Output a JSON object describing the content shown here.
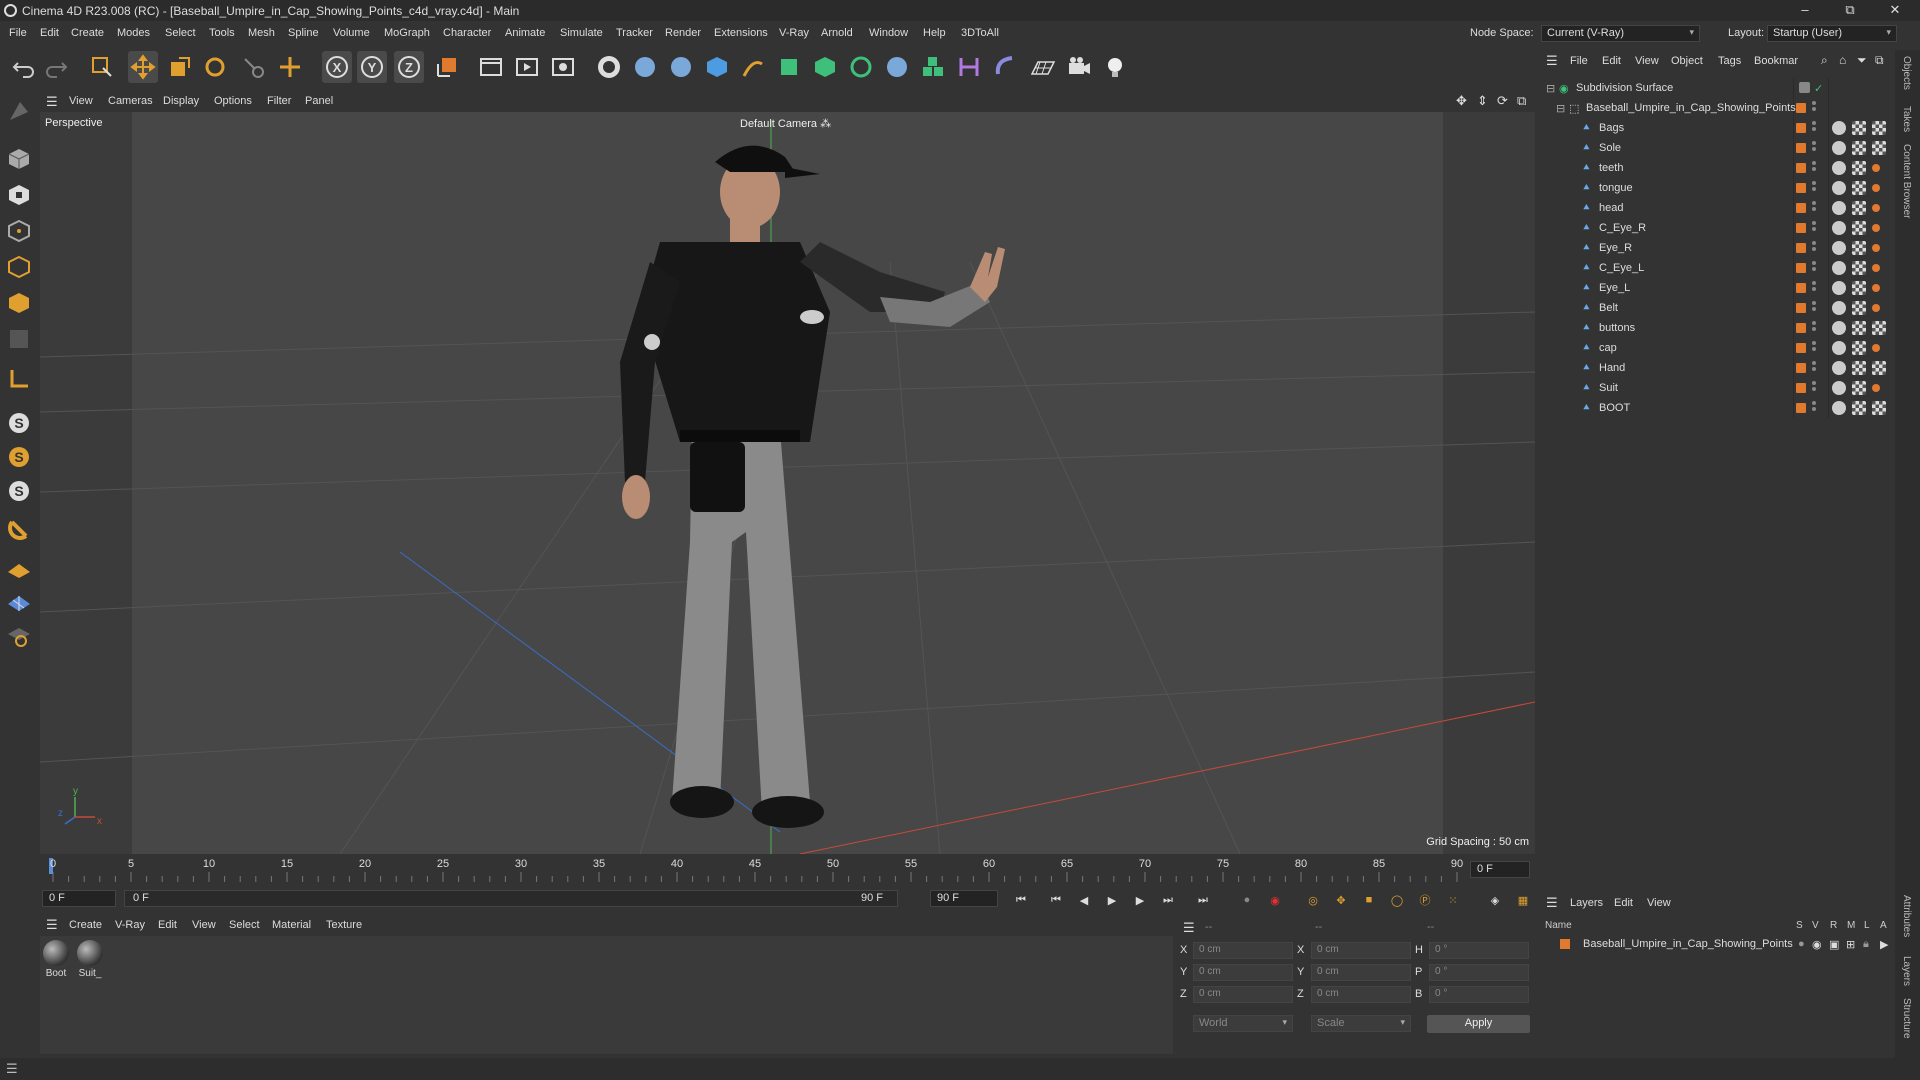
{
  "titlebar": {
    "title": "Cinema 4D R23.008 (RC) - [Baseball_Umpire_in_Cap_Showing_Points_c4d_vray.c4d] - Main",
    "minimize": "–",
    "restore": "⧉",
    "close": "✕"
  },
  "menubar": {
    "items": [
      "File",
      "Edit",
      "Create",
      "Modes",
      "Select",
      "Tools",
      "Mesh",
      "Spline",
      "Volume",
      "MoGraph",
      "Character",
      "Animate",
      "Simulate",
      "Tracker",
      "Render",
      "Extensions",
      "V-Ray",
      "Arnold",
      "Window",
      "Help",
      "3DToAll"
    ],
    "node_space_label": "Node Space:",
    "node_space_value": "Current (V-Ray)",
    "layout_label": "Layout:",
    "layout_value": "Startup (User)"
  },
  "toolbar": {
    "axis_x": "X",
    "axis_y": "Y",
    "axis_z": "Z"
  },
  "viewport": {
    "menu": [
      "View",
      "Cameras",
      "Display",
      "Options",
      "Filter",
      "Panel"
    ],
    "name": "Perspective",
    "camera": "Default Camera",
    "camera_glyph": "⁂",
    "grid_spacing": "Grid Spacing : 50 cm",
    "axis_y": "y",
    "axis_z": "z",
    "axis_x": "x"
  },
  "timeline": {
    "ticks": [
      "0",
      "5",
      "10",
      "15",
      "20",
      "25",
      "30",
      "35",
      "40",
      "45",
      "50",
      "55",
      "60",
      "65",
      "70",
      "75",
      "80",
      "85",
      "90"
    ],
    "current_frame_right": "0 F",
    "start_field": "0 F",
    "range_start": "0 F",
    "range_end": "90 F",
    "end_field": "90 F"
  },
  "materials": {
    "menu": [
      "Create",
      "V-Ray",
      "Edit",
      "View",
      "Select",
      "Material",
      "Texture"
    ],
    "items": [
      {
        "label": "Boot"
      },
      {
        "label": "Suit_"
      }
    ]
  },
  "coordinates": {
    "header_left": "--",
    "header_mid": "--",
    "header_right": "--",
    "rows": [
      {
        "axis": "X",
        "pos": "0 cm",
        "axis2": "X",
        "size": "0 cm",
        "rot_label": "H",
        "rot": "0 °"
      },
      {
        "axis": "Y",
        "pos": "0 cm",
        "axis2": "Y",
        "size": "0 cm",
        "rot_label": "P",
        "rot": "0 °"
      },
      {
        "axis": "Z",
        "pos": "0 cm",
        "axis2": "Z",
        "size": "0 cm",
        "rot_label": "B",
        "rot": "0 °"
      }
    ],
    "mode1": "World",
    "mode2": "Scale",
    "apply": "Apply"
  },
  "objects": {
    "menu": [
      "File",
      "Edit",
      "View",
      "Object",
      "Tags",
      "Bookmar"
    ],
    "root": "Subdivision Surface",
    "group": "Baseball_Umpire_in_Cap_Showing_Points",
    "children": [
      "Bags",
      "Sole",
      "teeth",
      "tongue",
      "head",
      "C_Eye_R",
      "Eye_R",
      "C_Eye_L",
      "Eye_L",
      "Belt",
      "buttons",
      "cap",
      "Hand",
      "Suit",
      "BOOT"
    ]
  },
  "layers": {
    "menu": [
      "Layers",
      "Edit",
      "View"
    ],
    "col_name": "Name",
    "cols": [
      "S",
      "V",
      "R",
      "M",
      "L",
      "A"
    ],
    "row": "Baseball_Umpire_in_Cap_Showing_Points"
  },
  "side_tabs": [
    "Objects",
    "Takes",
    "Content Browser",
    "Attributes",
    "Layers",
    "Structure"
  ],
  "colors": {
    "accent_orange": "#e07a2f",
    "axis_green": "#4db34d",
    "axis_red": "#c84a3a",
    "axis_blue": "#3a6ec8"
  }
}
